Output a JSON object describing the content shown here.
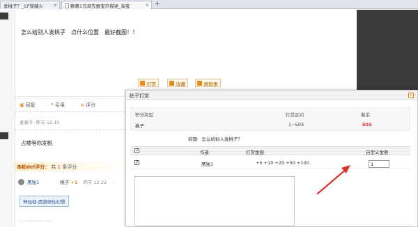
{
  "browser": {
    "tab1_title": "发桃子？_CF穿越火",
    "tab2_title": "敷裹1元询先蚕宝贝描述_淘宝",
    "new_tab": "+"
  },
  "post": {
    "title": "怎么给别人发桃子　点什么位置　最好截图！！",
    "actions": [
      "打赏",
      "收藏",
      "刷鲜事"
    ],
    "meta": {
      "reply": "回复",
      "quote": "引用",
      "rate": "评分"
    },
    "time": "发表于: 昨天 12:15"
  },
  "reply": {
    "text": "占楼等你发桃",
    "rating_label": "本帖del评分：",
    "rating_text_pre": "共",
    "rating_count": "1",
    "rating_text_post": "条评分",
    "rater": "鹰独1",
    "item": "桃子",
    "amount": "+1",
    "rating_time": "昨天 12:22",
    "more": "-",
    "signature": "神仙劫-西游修仙幻想"
  },
  "dialog": {
    "title": "帖子打赏",
    "close": "×",
    "info": {
      "col1_head": "积分类型",
      "col2_head": "打赏区间",
      "col3_head": "剩余",
      "col1_val": "桃子",
      "col2_val": "1~503",
      "col3_val": "503"
    },
    "subject_label": "标题:",
    "subject": "怎么给别人发桃子？",
    "table": {
      "headers": [
        "作者",
        "打赏金额",
        "自定义金额"
      ],
      "row": {
        "author": "鹰独1",
        "amounts": "+5 +10 +20 +50 +100",
        "custom": "1"
      }
    }
  },
  "watermark": "bbs.duowan.com",
  "colors": {
    "accent": "#e48a1d",
    "red": "#e23",
    "arrow": "#d9342b",
    "dark_panel": "#3b3b3b"
  }
}
